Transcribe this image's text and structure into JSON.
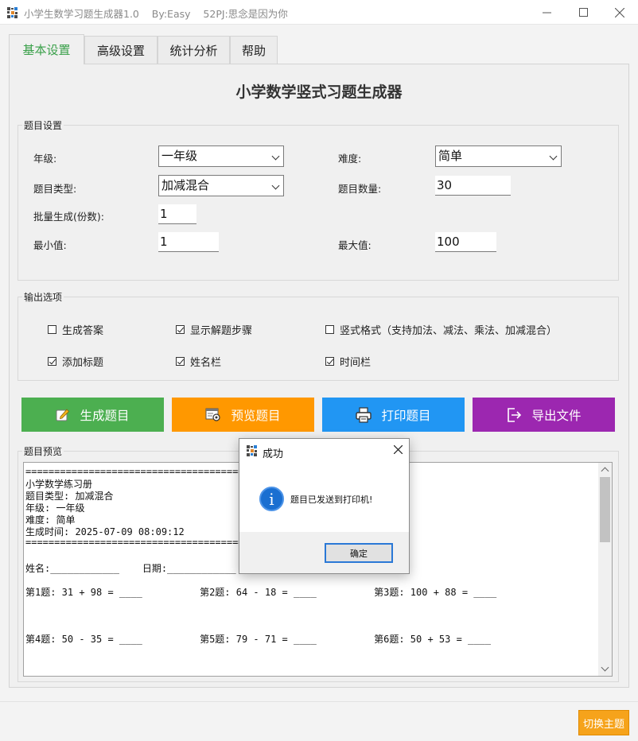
{
  "window": {
    "title": "小学生数学习题生成器1.0    By:Easy    52PJ:思念是因为你",
    "minimize_icon": "minimize-icon",
    "maximize_icon": "maximize-icon",
    "close_icon": "close-icon"
  },
  "tabs": [
    {
      "label": "基本设置",
      "active": true
    },
    {
      "label": "高级设置",
      "active": false
    },
    {
      "label": "统计分析",
      "active": false
    },
    {
      "label": "帮助",
      "active": false
    }
  ],
  "main_title": "小学数学竖式习题生成器",
  "settings": {
    "group_title": "题目设置",
    "grade_label": "年级:",
    "grade_value": "一年级",
    "difficulty_label": "难度:",
    "difficulty_value": "简单",
    "type_label": "题目类型:",
    "type_value": "加减混合",
    "count_label": "题目数量:",
    "count_value": "30",
    "batch_label": "批量生成(份数):",
    "batch_value": "1",
    "min_label": "最小值:",
    "min_value": "1",
    "max_label": "最大值:",
    "max_value": "100"
  },
  "output": {
    "group_title": "输出选项",
    "options": [
      {
        "label": "生成答案",
        "checked": false
      },
      {
        "label": "显示解题步骤",
        "checked": true
      },
      {
        "label": "竖式格式（支持加法、减法、乘法、加减混合）",
        "checked": false
      },
      {
        "label": "添加标题",
        "checked": true
      },
      {
        "label": "姓名栏",
        "checked": true
      },
      {
        "label": "时间栏",
        "checked": true
      }
    ]
  },
  "actions": [
    {
      "label": "生成题目",
      "color": "#4caf50",
      "icon": "edit-icon"
    },
    {
      "label": "预览题目",
      "color": "#ff9800",
      "icon": "preview-icon"
    },
    {
      "label": "打印题目",
      "color": "#2196f3",
      "icon": "printer-icon"
    },
    {
      "label": "导出文件",
      "color": "#9c27b0",
      "icon": "export-icon"
    }
  ],
  "preview": {
    "group_title": "题目预览",
    "lines": [
      "==================================================",
      "小学数学练习册",
      "题目类型: 加减混合",
      "年级: 一年级",
      "难度: 简单",
      "生成时间: 2025-07-09 08:09:12",
      "==================================================",
      "",
      "姓名:____________    日期:____________",
      "",
      "第1题: 31 + 98 = ____          第2题: 64 - 18 = ____          第3题: 100 + 88 = ____",
      "",
      "",
      "",
      "第4题: 50 - 35 = ____          第5题: 79 - 71 = ____          第6题: 50 + 53 = ____"
    ]
  },
  "dialog": {
    "title": "成功",
    "message": "题目已发送到打印机!",
    "ok_label": "确定",
    "icon": "info-icon"
  },
  "theme_button": "切换主题"
}
